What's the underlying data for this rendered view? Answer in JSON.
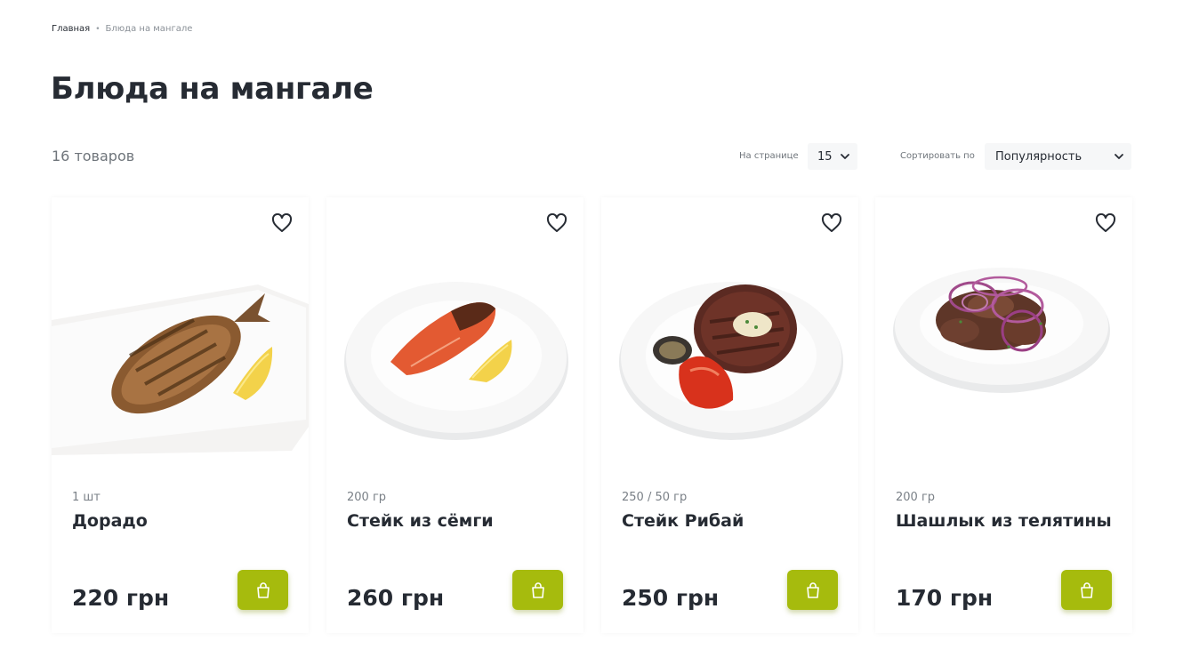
{
  "breadcrumb": {
    "home": "Главная",
    "current": "Блюда на мангале"
  },
  "page_title": "Блюда на мангале",
  "count_text": "16 товаров",
  "per_page": {
    "label": "На странице",
    "value": "15"
  },
  "sort": {
    "label": "Сортировать по",
    "value": "Популярность"
  },
  "colors": {
    "accent": "#a6bb0d",
    "text": "#262b33",
    "muted": "#7a8087"
  },
  "products": [
    {
      "weight": "1 шт",
      "name": "Дорадо",
      "price": "220 грн"
    },
    {
      "weight": "200 гр",
      "name": "Стейк из сёмги",
      "price": "260 грн"
    },
    {
      "weight": "250 / 50 гр",
      "name": "Стейк Рибай",
      "price": "250 грн"
    },
    {
      "weight": "200 гр",
      "name": "Шашлык из телятины",
      "price": "170 грн"
    }
  ]
}
